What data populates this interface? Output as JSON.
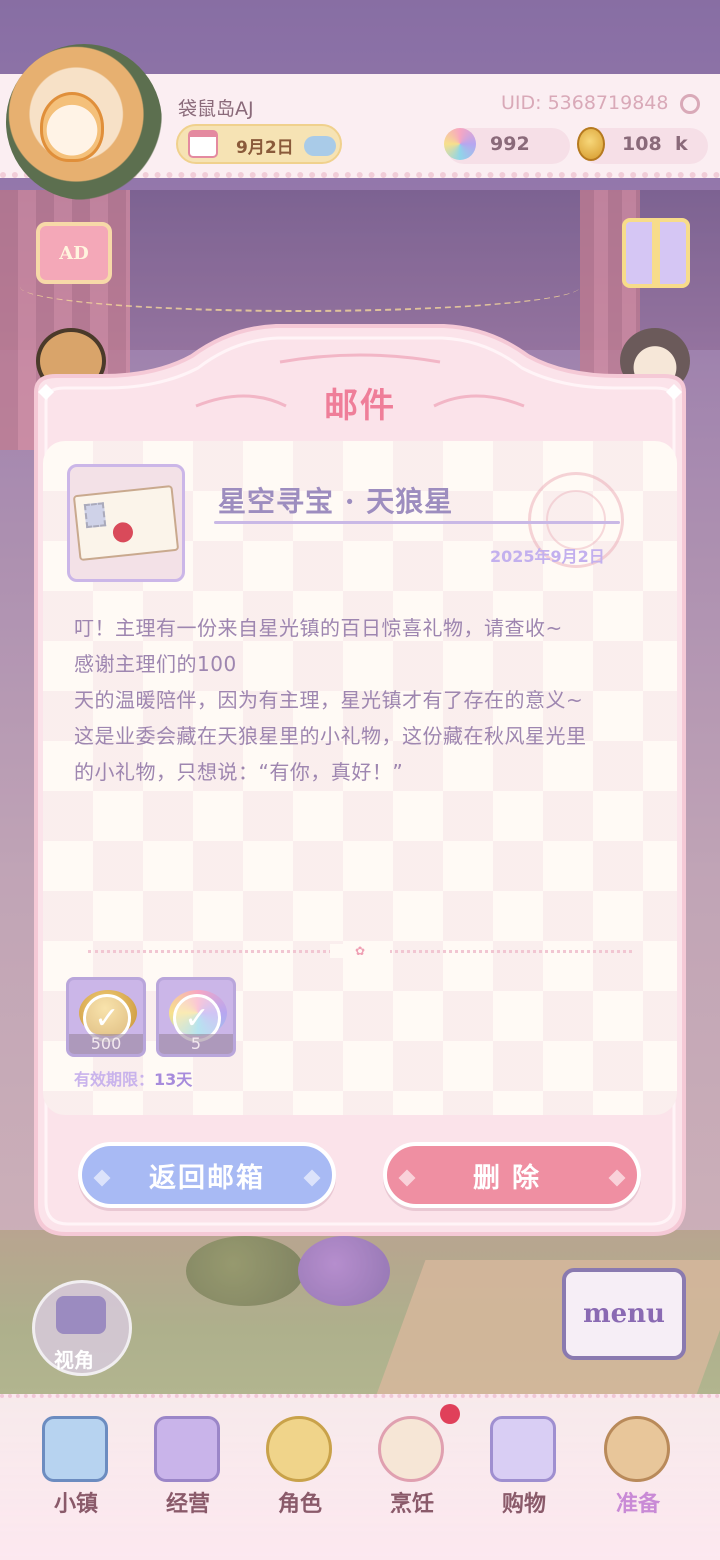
{
  "hud": {
    "player_name": "袋鼠岛AJ",
    "date": "9月2日",
    "uid": "UID: 5368719848",
    "gems": "992",
    "coins": "108",
    "coins_unit": "k"
  },
  "side_buttons": {
    "ad_label": "AD"
  },
  "mail": {
    "title": "邮件",
    "subject": "星空寻宝 · 天狼星",
    "date": "2025年9月2日",
    "body_lines": [
      "叮！主理有一份来自星光镇的百日惊喜礼物，请查收~",
      "感谢主理们的100",
      "天的温暖陪伴，因为有主理，星光镇才有了存在的意义~",
      "这是业委会藏在天狼星里的小礼物，这份藏在秋风星光里",
      "的小礼物，只想说：“有你，真好！”"
    ],
    "rewards": [
      {
        "icon": "coin-stack-icon",
        "quantity": "500",
        "claimed": true
      },
      {
        "icon": "rainbow-gem-icon",
        "quantity": "5",
        "claimed": true
      }
    ],
    "expiry_label": "有效期限：",
    "expiry_value": "13天",
    "back_button": "返回邮箱",
    "delete_button": "删除"
  },
  "bottom": {
    "camera_label": "视角",
    "menu_label": "menu",
    "nav": [
      {
        "label": "小镇",
        "icon": "town-map-icon"
      },
      {
        "label": "经营",
        "icon": "shop-manage-icon"
      },
      {
        "label": "角色",
        "icon": "character-icon"
      },
      {
        "label": "烹饪",
        "icon": "cooking-icon"
      },
      {
        "label": "购物",
        "icon": "shopping-bag-icon"
      },
      {
        "label": "准备",
        "icon": "prepare-basket-icon"
      }
    ]
  },
  "colors": {
    "title_pink": "#ef7e99",
    "subject_purple": "#9d8dbf",
    "body_text": "#9e86b0",
    "back_button": "#a8baf4",
    "delete_button": "#ef8fa2",
    "modal_frame": "#fbe3ea"
  }
}
